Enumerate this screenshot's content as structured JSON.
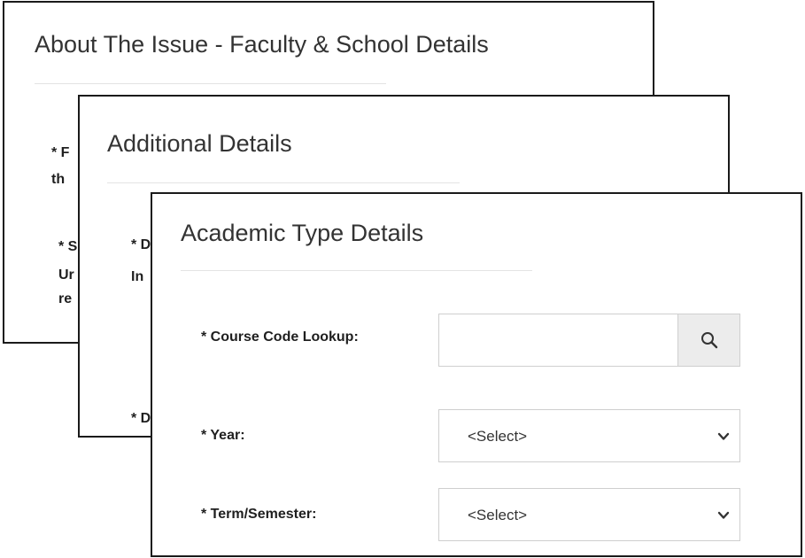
{
  "panels": {
    "issue": {
      "title": "About The Issue - Faculty & School Details",
      "fragments": [
        "* F",
        "th",
        "* S",
        "Ur",
        "re"
      ]
    },
    "additional": {
      "title": "Additional Details",
      "fragments": [
        "* D",
        "In",
        "* D"
      ]
    },
    "academic": {
      "title": "Academic Type Details",
      "course_code_label": "* Course Code Lookup:",
      "course_code_value": "",
      "year_label": "* Year:",
      "year_value": "<Select>",
      "term_label": "* Term/Semester:",
      "term_value": "<Select>"
    }
  },
  "icons": {
    "search": "search-icon",
    "dropdown": "chevron-down-icon"
  },
  "colors": {
    "panel_border": "#1a1a1a",
    "button_bg": "#ececec",
    "input_border": "#cfcfcf"
  }
}
